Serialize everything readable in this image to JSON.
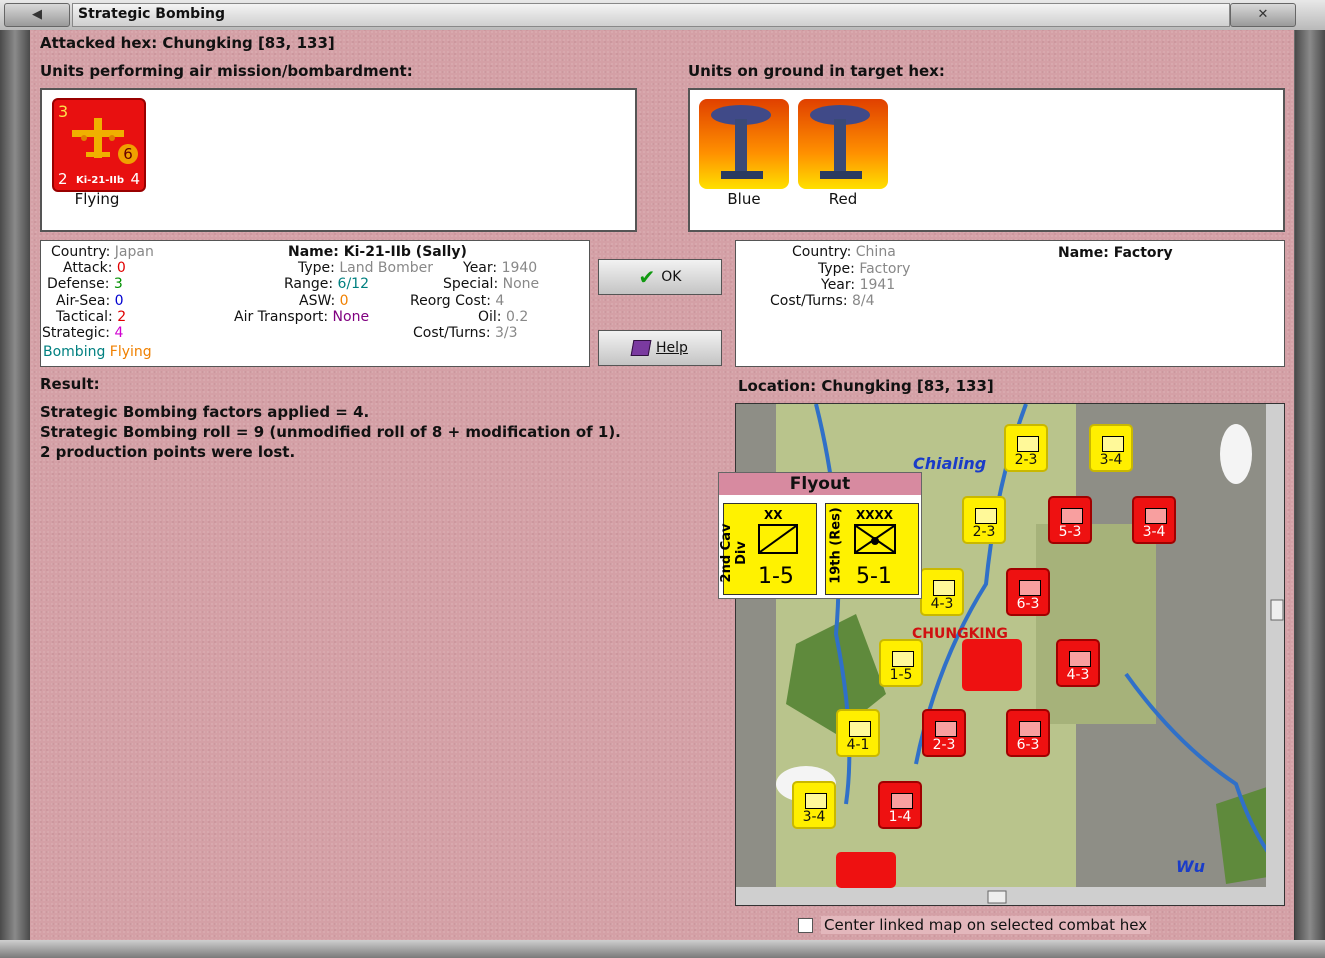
{
  "window": {
    "title": "Strategic Bombing"
  },
  "header": {
    "attacked_hex": "Attacked hex: Chungking [83, 133]",
    "left_section": "Units performing air mission/bombardment:",
    "right_section": "Units on ground in target hex:"
  },
  "attacker_units": [
    {
      "name": "Ki-21-IIb",
      "label": "Flying",
      "attack_val": "3",
      "strategic_val": "6",
      "tactical_val": "2",
      "defense_val": "4"
    }
  ],
  "ground_units": [
    {
      "label": "Blue"
    },
    {
      "label": "Red"
    }
  ],
  "attacker_stats": {
    "country_k": "Country:",
    "country_v": "Japan",
    "attack_k": "Attack:",
    "attack_v": "0",
    "defense_k": "Defense:",
    "defense_v": "3",
    "airsea_k": "Air-Sea:",
    "airsea_v": "0",
    "tactical_k": "Tactical:",
    "tactical_v": "2",
    "strategic_k": "Strategic:",
    "strategic_v": "4",
    "mission_a": "Bombing",
    "mission_b": "Flying",
    "name_k": "Name:",
    "name_v": "Ki-21-IIb (Sally)",
    "type_k": "Type:",
    "type_v": "Land Bomber",
    "year_k": "Year:",
    "year_v": "1940",
    "range_k": "Range:",
    "range_v": "6/12",
    "special_k": "Special:",
    "special_v": "None",
    "asw_k": "ASW:",
    "asw_v": "0",
    "reorg_k": "Reorg Cost:",
    "reorg_v": "4",
    "airtransport_k": "Air Transport:",
    "airtransport_v": "None",
    "oil_k": "Oil:",
    "oil_v": "0.2",
    "costturns_k": "Cost/Turns:",
    "costturns_v": "3/3"
  },
  "buttons": {
    "ok": "OK",
    "help": "Help"
  },
  "target_stats": {
    "country_k": "Country:",
    "country_v": "China",
    "type_k": "Type:",
    "type_v": "Factory",
    "year_k": "Year:",
    "year_v": "1941",
    "costturns_k": "Cost/Turns:",
    "costturns_v": "8/4",
    "name_k": "Name:",
    "name_v": "Factory"
  },
  "result": {
    "heading": "Result:",
    "lines": [
      "Strategic Bombing factors applied = 4.",
      "Strategic Bombing roll = 9 (unmodified roll of 8 + modification of 1).",
      "2 production points were lost."
    ]
  },
  "map": {
    "location": "Location:  Chungking  [83, 133]",
    "labels": {
      "chialing": "Chialing",
      "wu": "Wu",
      "city": "CHUNGKING"
    },
    "flyout": {
      "title": "Flyout",
      "units": [
        {
          "side_label": "2nd Cav Div",
          "size": "XX",
          "value": "1-5"
        },
        {
          "side_label": "19th (Res)",
          "size": "XXXX",
          "value": "5-1"
        }
      ]
    },
    "counters": [
      {
        "value": "2-3",
        "color": "yellow"
      },
      {
        "value": "3-4",
        "color": "yellow"
      },
      {
        "value": "2-3",
        "color": "yellow"
      },
      {
        "value": "5-3",
        "color": "red"
      },
      {
        "value": "3-4",
        "color": "red"
      },
      {
        "value": "4-3",
        "color": "yellow"
      },
      {
        "value": "6-3",
        "color": "red"
      },
      {
        "value": "1-5",
        "color": "yellow"
      },
      {
        "value": "4-3",
        "color": "red"
      },
      {
        "value": "4-1",
        "color": "yellow"
      },
      {
        "value": "2-3",
        "color": "red"
      },
      {
        "value": "6-3",
        "color": "red"
      },
      {
        "value": "3-4",
        "color": "yellow"
      },
      {
        "value": "1-4",
        "color": "red"
      }
    ],
    "checkbox_label": "Center linked map on selected combat hex"
  }
}
